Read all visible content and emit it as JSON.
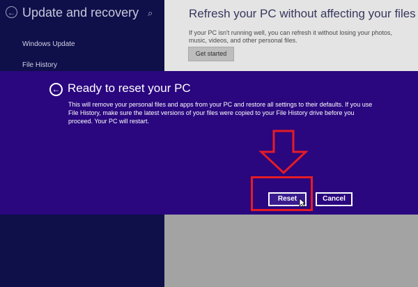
{
  "settings": {
    "title": "Update and recovery",
    "nav_items": [
      "Windows Update",
      "File History"
    ]
  },
  "refresh_panel": {
    "title": "Refresh your PC without affecting your files",
    "description": "If your PC isn't running well, you can refresh it without losing your photos, music, videos, and other personal files.",
    "button_label": "Get started"
  },
  "dialog": {
    "title": "Ready to reset your PC",
    "body": "This will remove your personal files and apps from your PC and restore all settings to their defaults. If you use File History, make sure the latest versions of your files were copied to your File History drive before you proceed. Your PC will restart.",
    "reset_label": "Reset",
    "cancel_label": "Cancel"
  },
  "icons": {
    "back": "back-arrow-icon",
    "search": "search-icon",
    "annotation_arrow": "red-down-arrow-icon",
    "cursor": "mouse-pointer-icon"
  },
  "colors": {
    "dialog_background": "#2a067f",
    "left_pane": "#0f0f4a",
    "annotation": "#e51c24"
  }
}
